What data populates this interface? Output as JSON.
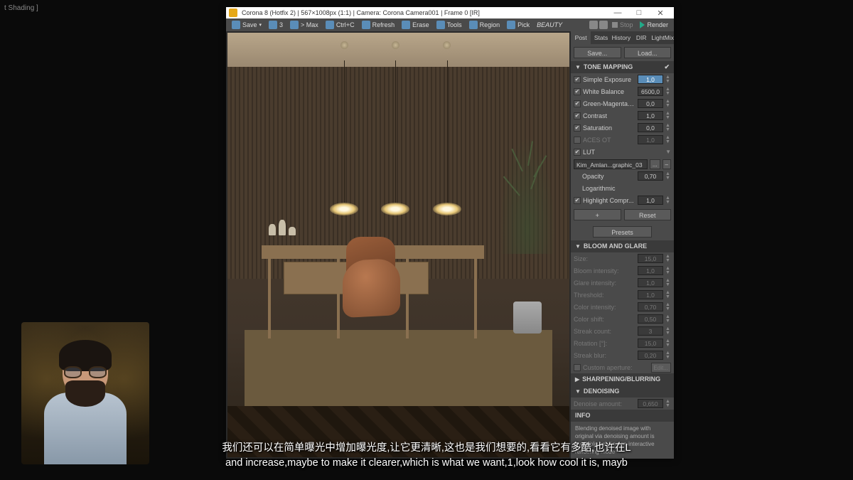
{
  "bg_label": "t Shading ]",
  "titlebar": {
    "text": "Corona 8 (Hotfix 2) | 567×1008px (1:1) | Camera: Corona Camera001 | Frame 0 [IR]"
  },
  "toolbar": {
    "save": "Save",
    "three": "3",
    "max": "> Max",
    "ctrlc": "Ctrl+C",
    "refresh": "Refresh",
    "erase": "Erase",
    "tools": "Tools",
    "region": "Region",
    "pick": "Pick",
    "beauty": "BEAUTY",
    "stop": "Stop",
    "render": "Render"
  },
  "tabs": {
    "post": "Post",
    "stats": "Stats",
    "history": "History",
    "dir": "DIR",
    "lightmix": "LightMix"
  },
  "buttons": {
    "save": "Save...",
    "load": "Load..."
  },
  "sections": {
    "tone": "TONE MAPPING",
    "bloom": "BLOOM AND GLARE",
    "sharp": "SHARPENING/BLURRING",
    "denoise": "DENOISING",
    "info": "INFO"
  },
  "tone": {
    "simple_exposure": {
      "label": "Simple Exposure",
      "value": "1,0"
    },
    "white_balance": {
      "label": "White Balance",
      "value": "6500,0"
    },
    "green_magenta": {
      "label": "Green-Magenta Ti...",
      "value": "0,0"
    },
    "contrast": {
      "label": "Contrast",
      "value": "1,0"
    },
    "saturation": {
      "label": "Saturation",
      "value": "0,0"
    },
    "aces": {
      "label": "ACES OT",
      "value": "1,0"
    },
    "lut": {
      "label": "LUT",
      "file": "Kim_Amlan...graphic_03"
    },
    "opacity": {
      "label": "Opacity",
      "value": "0,70"
    },
    "logarithmic": {
      "label": "Logarithmic"
    },
    "highlight": {
      "label": "Highlight Compr...",
      "value": "1,0"
    },
    "plus": "+",
    "reset": "Reset",
    "presets": "Presets"
  },
  "bloom": {
    "size": {
      "label": "Size:",
      "value": "15,0"
    },
    "bloom_int": {
      "label": "Bloom intensity:",
      "value": "1,0"
    },
    "glare_int": {
      "label": "Glare intensity:",
      "value": "1,0"
    },
    "threshold": {
      "label": "Threshold:",
      "value": "1,0"
    },
    "color_int": {
      "label": "Color intensity:",
      "value": "0,70"
    },
    "color_shift": {
      "label": "Color shift:",
      "value": "0,50"
    },
    "streak_count": {
      "label": "Streak count:",
      "value": "3"
    },
    "rotation": {
      "label": "Rotation [°]:",
      "value": "15,0"
    },
    "streak_blur": {
      "label": "Streak blur:",
      "value": "0,20"
    },
    "custom": {
      "label": "Custom aperture:",
      "edit": "Edit..."
    }
  },
  "denoise": {
    "amount_label": "Denoise amount:",
    "amount": "0,650"
  },
  "info_text": "Blending denoised image with original via denoising amount is available only in non-interactive rendering mode",
  "subtitles": {
    "cn": "我们还可以在简单曝光中增加曝光度,让它更清晰,这也是我们想要的,看看它有多酷,也许在L",
    "en": "and increase,maybe to make it clearer,which is what we want,1,look how cool it is, mayb"
  }
}
